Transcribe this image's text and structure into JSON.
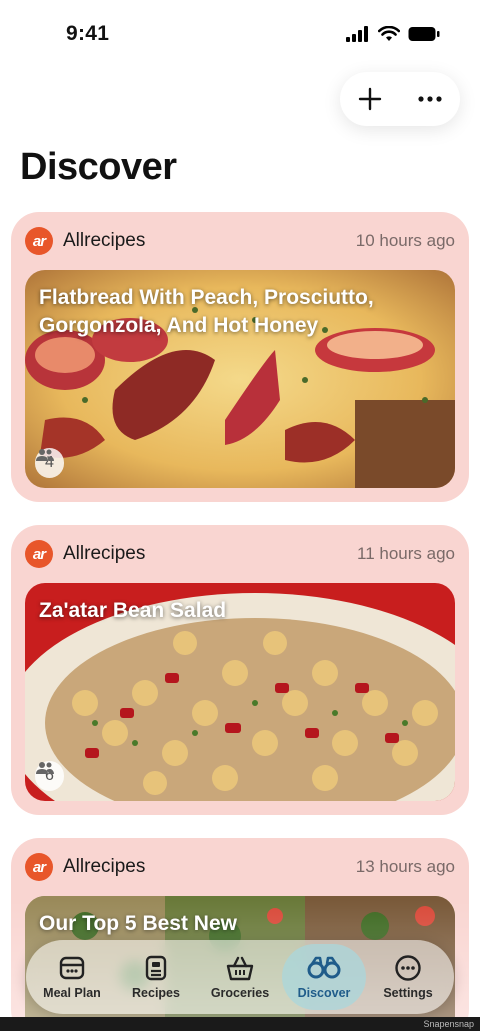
{
  "status_bar": {
    "time": "9:41"
  },
  "page": {
    "title": "Discover"
  },
  "cards": [
    {
      "source": "Allrecipes",
      "logo_text": "ar",
      "time": "10 hours ago",
      "title": "Flatbread With Peach, Prosciutto, Gorgonzola, And Hot Honey",
      "servings": "4"
    },
    {
      "source": "Allrecipes",
      "logo_text": "ar",
      "time": "11 hours ago",
      "title": "Za'atar Bean Salad",
      "servings": "6"
    },
    {
      "source": "Allrecipes",
      "logo_text": "ar",
      "time": "13 hours ago",
      "title": "Our Top 5 Best New",
      "servings": ""
    }
  ],
  "tabs": [
    {
      "label": "Meal Plan",
      "icon": "meal-plan-icon"
    },
    {
      "label": "Recipes",
      "icon": "recipes-icon"
    },
    {
      "label": "Groceries",
      "icon": "basket-icon"
    },
    {
      "label": "Discover",
      "icon": "binoculars-icon",
      "active": true
    },
    {
      "label": "Settings",
      "icon": "more-icon"
    }
  ],
  "watermark": "Snapensnap",
  "colors": {
    "card_bg": "#f9d5d1",
    "accent": "#1f5c8a",
    "logo": "#e8562a"
  }
}
